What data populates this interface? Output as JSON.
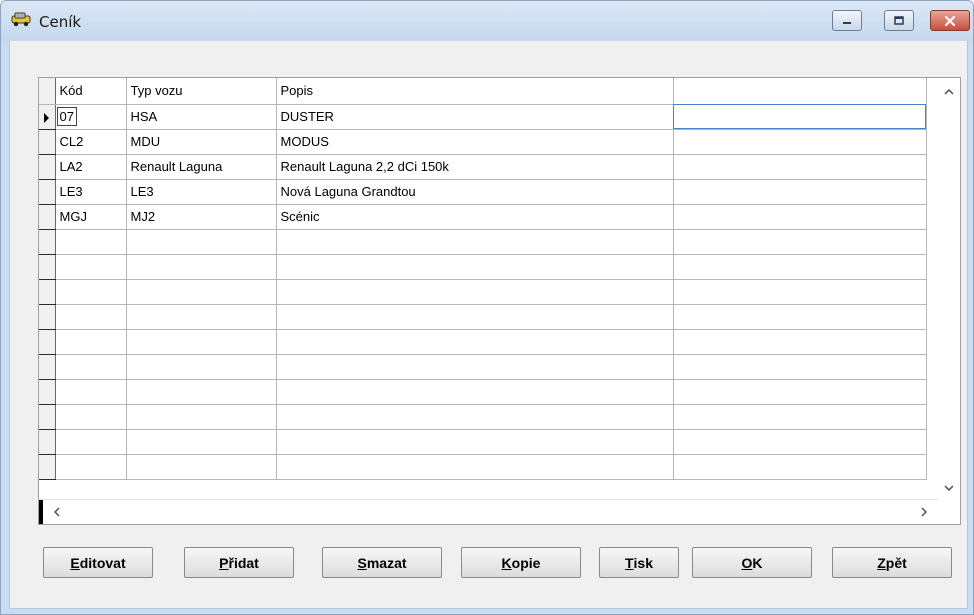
{
  "window": {
    "title": "Ceník",
    "icon": "car-icon",
    "controls": [
      "minimize-icon",
      "maximize-icon",
      "close-icon"
    ],
    "close_color": "#c7503c"
  },
  "grid": {
    "columns": [
      "Kód",
      "Typ vozu",
      "Popis",
      ""
    ],
    "rows": [
      {
        "kod": "07",
        "typ": "HSA",
        "popis": "DUSTER"
      },
      {
        "kod": "CL2",
        "typ": "MDU",
        "popis": "MODUS"
      },
      {
        "kod": "LA2",
        "typ": "Renault Laguna",
        "popis": "Renault Laguna 2,2 dCi 150k"
      },
      {
        "kod": "LE3",
        "typ": "LE3",
        "popis": "Nová Laguna Grandtou"
      },
      {
        "kod": "MGJ",
        "typ": "MJ2",
        "popis": "Scénic"
      }
    ],
    "empty_rows": 10,
    "current_row": 0,
    "selection_color": "#4a82c8"
  },
  "scroll": {
    "up": "‸",
    "down": "⌄",
    "left": "‹",
    "right": "›"
  },
  "buttons": [
    {
      "key": "editovat",
      "pre": "",
      "u": "E",
      "post": "ditovat"
    },
    {
      "key": "pridat",
      "pre": "",
      "u": "P",
      "post": "řidat"
    },
    {
      "key": "smazat",
      "pre": "",
      "u": "S",
      "post": "mazat"
    },
    {
      "key": "kopie",
      "pre": "",
      "u": "K",
      "post": "opie"
    },
    {
      "key": "tisk",
      "pre": "",
      "u": "T",
      "post": "isk"
    },
    {
      "key": "ok",
      "pre": "",
      "u": "O",
      "post": "K"
    },
    {
      "key": "zpet",
      "pre": "",
      "u": "Z",
      "post": "pět"
    }
  ]
}
